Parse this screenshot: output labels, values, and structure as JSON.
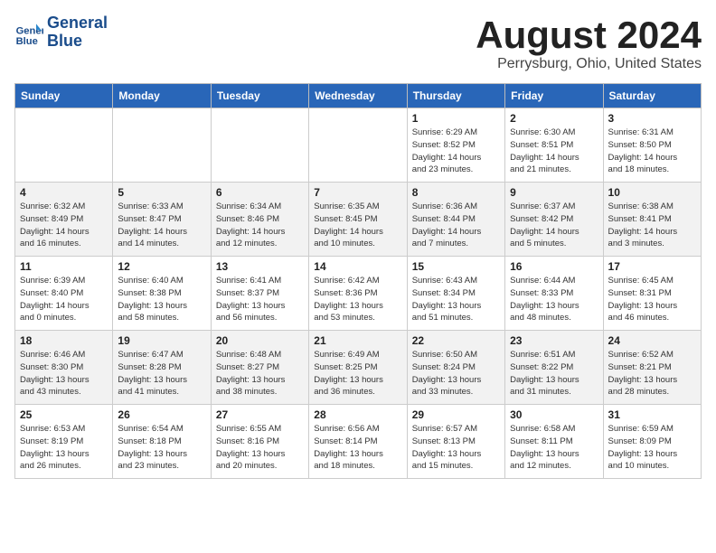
{
  "logo": {
    "line1": "General",
    "line2": "Blue"
  },
  "title": "August 2024",
  "location": "Perrysburg, Ohio, United States",
  "days_of_week": [
    "Sunday",
    "Monday",
    "Tuesday",
    "Wednesday",
    "Thursday",
    "Friday",
    "Saturday"
  ],
  "weeks": [
    [
      {
        "day": "",
        "info": ""
      },
      {
        "day": "",
        "info": ""
      },
      {
        "day": "",
        "info": ""
      },
      {
        "day": "",
        "info": ""
      },
      {
        "day": "1",
        "info": "Sunrise: 6:29 AM\nSunset: 8:52 PM\nDaylight: 14 hours\nand 23 minutes."
      },
      {
        "day": "2",
        "info": "Sunrise: 6:30 AM\nSunset: 8:51 PM\nDaylight: 14 hours\nand 21 minutes."
      },
      {
        "day": "3",
        "info": "Sunrise: 6:31 AM\nSunset: 8:50 PM\nDaylight: 14 hours\nand 18 minutes."
      }
    ],
    [
      {
        "day": "4",
        "info": "Sunrise: 6:32 AM\nSunset: 8:49 PM\nDaylight: 14 hours\nand 16 minutes."
      },
      {
        "day": "5",
        "info": "Sunrise: 6:33 AM\nSunset: 8:47 PM\nDaylight: 14 hours\nand 14 minutes."
      },
      {
        "day": "6",
        "info": "Sunrise: 6:34 AM\nSunset: 8:46 PM\nDaylight: 14 hours\nand 12 minutes."
      },
      {
        "day": "7",
        "info": "Sunrise: 6:35 AM\nSunset: 8:45 PM\nDaylight: 14 hours\nand 10 minutes."
      },
      {
        "day": "8",
        "info": "Sunrise: 6:36 AM\nSunset: 8:44 PM\nDaylight: 14 hours\nand 7 minutes."
      },
      {
        "day": "9",
        "info": "Sunrise: 6:37 AM\nSunset: 8:42 PM\nDaylight: 14 hours\nand 5 minutes."
      },
      {
        "day": "10",
        "info": "Sunrise: 6:38 AM\nSunset: 8:41 PM\nDaylight: 14 hours\nand 3 minutes."
      }
    ],
    [
      {
        "day": "11",
        "info": "Sunrise: 6:39 AM\nSunset: 8:40 PM\nDaylight: 14 hours\nand 0 minutes."
      },
      {
        "day": "12",
        "info": "Sunrise: 6:40 AM\nSunset: 8:38 PM\nDaylight: 13 hours\nand 58 minutes."
      },
      {
        "day": "13",
        "info": "Sunrise: 6:41 AM\nSunset: 8:37 PM\nDaylight: 13 hours\nand 56 minutes."
      },
      {
        "day": "14",
        "info": "Sunrise: 6:42 AM\nSunset: 8:36 PM\nDaylight: 13 hours\nand 53 minutes."
      },
      {
        "day": "15",
        "info": "Sunrise: 6:43 AM\nSunset: 8:34 PM\nDaylight: 13 hours\nand 51 minutes."
      },
      {
        "day": "16",
        "info": "Sunrise: 6:44 AM\nSunset: 8:33 PM\nDaylight: 13 hours\nand 48 minutes."
      },
      {
        "day": "17",
        "info": "Sunrise: 6:45 AM\nSunset: 8:31 PM\nDaylight: 13 hours\nand 46 minutes."
      }
    ],
    [
      {
        "day": "18",
        "info": "Sunrise: 6:46 AM\nSunset: 8:30 PM\nDaylight: 13 hours\nand 43 minutes."
      },
      {
        "day": "19",
        "info": "Sunrise: 6:47 AM\nSunset: 8:28 PM\nDaylight: 13 hours\nand 41 minutes."
      },
      {
        "day": "20",
        "info": "Sunrise: 6:48 AM\nSunset: 8:27 PM\nDaylight: 13 hours\nand 38 minutes."
      },
      {
        "day": "21",
        "info": "Sunrise: 6:49 AM\nSunset: 8:25 PM\nDaylight: 13 hours\nand 36 minutes."
      },
      {
        "day": "22",
        "info": "Sunrise: 6:50 AM\nSunset: 8:24 PM\nDaylight: 13 hours\nand 33 minutes."
      },
      {
        "day": "23",
        "info": "Sunrise: 6:51 AM\nSunset: 8:22 PM\nDaylight: 13 hours\nand 31 minutes."
      },
      {
        "day": "24",
        "info": "Sunrise: 6:52 AM\nSunset: 8:21 PM\nDaylight: 13 hours\nand 28 minutes."
      }
    ],
    [
      {
        "day": "25",
        "info": "Sunrise: 6:53 AM\nSunset: 8:19 PM\nDaylight: 13 hours\nand 26 minutes."
      },
      {
        "day": "26",
        "info": "Sunrise: 6:54 AM\nSunset: 8:18 PM\nDaylight: 13 hours\nand 23 minutes."
      },
      {
        "day": "27",
        "info": "Sunrise: 6:55 AM\nSunset: 8:16 PM\nDaylight: 13 hours\nand 20 minutes."
      },
      {
        "day": "28",
        "info": "Sunrise: 6:56 AM\nSunset: 8:14 PM\nDaylight: 13 hours\nand 18 minutes."
      },
      {
        "day": "29",
        "info": "Sunrise: 6:57 AM\nSunset: 8:13 PM\nDaylight: 13 hours\nand 15 minutes."
      },
      {
        "day": "30",
        "info": "Sunrise: 6:58 AM\nSunset: 8:11 PM\nDaylight: 13 hours\nand 12 minutes."
      },
      {
        "day": "31",
        "info": "Sunrise: 6:59 AM\nSunset: 8:09 PM\nDaylight: 13 hours\nand 10 minutes."
      }
    ]
  ]
}
